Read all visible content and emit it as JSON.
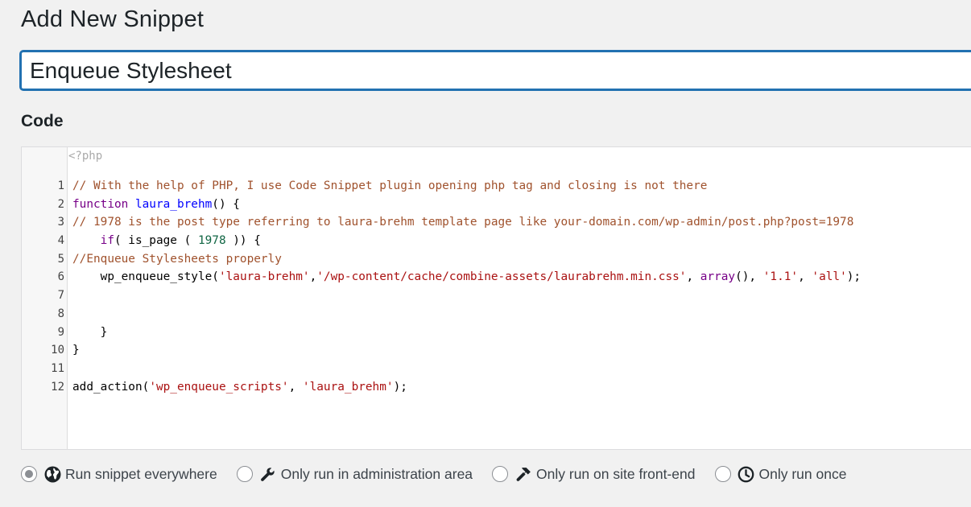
{
  "header": {
    "title": "Add New Snippet"
  },
  "snippet": {
    "name_value": "Enqueue Stylesheet"
  },
  "code_section": {
    "label": "Code"
  },
  "editor": {
    "php_open_tag": "<?php",
    "lines": [
      {
        "num": "1",
        "text": "// With the help of PHP, I use Code Snippet plugin opening php tag and closing is not there"
      },
      {
        "num": "2",
        "text": "function laura_brehm() {"
      },
      {
        "num": "3",
        "text": "// 1978 is the post type referring to laura-brehm template page like your-domain.com/wp-admin/post.php?post=1978"
      },
      {
        "num": "4",
        "text": "    if( is_page ( 1978 )) {"
      },
      {
        "num": "5",
        "text": "//Enqueue Stylesheets properly"
      },
      {
        "num": "6",
        "text": "    wp_enqueue_style('laura-brehm','/wp-content/cache/combine-assets/laurabrehm.min.css', array(), '1.1', 'all');"
      },
      {
        "num": "7",
        "text": ""
      },
      {
        "num": "8",
        "text": ""
      },
      {
        "num": "9",
        "text": "    }"
      },
      {
        "num": "10",
        "text": "}"
      },
      {
        "num": "11",
        "text": ""
      },
      {
        "num": "12",
        "text": "add_action('wp_enqueue_scripts', 'laura_brehm');"
      }
    ]
  },
  "run_options": [
    {
      "label": "Run snippet everywhere",
      "icon": "globe-icon",
      "checked": true
    },
    {
      "label": "Only run in administration area",
      "icon": "wrench-icon",
      "checked": false
    },
    {
      "label": "Only run on site front-end",
      "icon": "hammer-icon",
      "checked": false
    },
    {
      "label": "Only run once",
      "icon": "clock-icon",
      "checked": false
    }
  ],
  "colors": {
    "accent": "#2271b1",
    "comment": "#a0522d",
    "keyword": "#770088",
    "string": "#aa1111",
    "number": "#116644",
    "function_name": "#0000ff"
  }
}
